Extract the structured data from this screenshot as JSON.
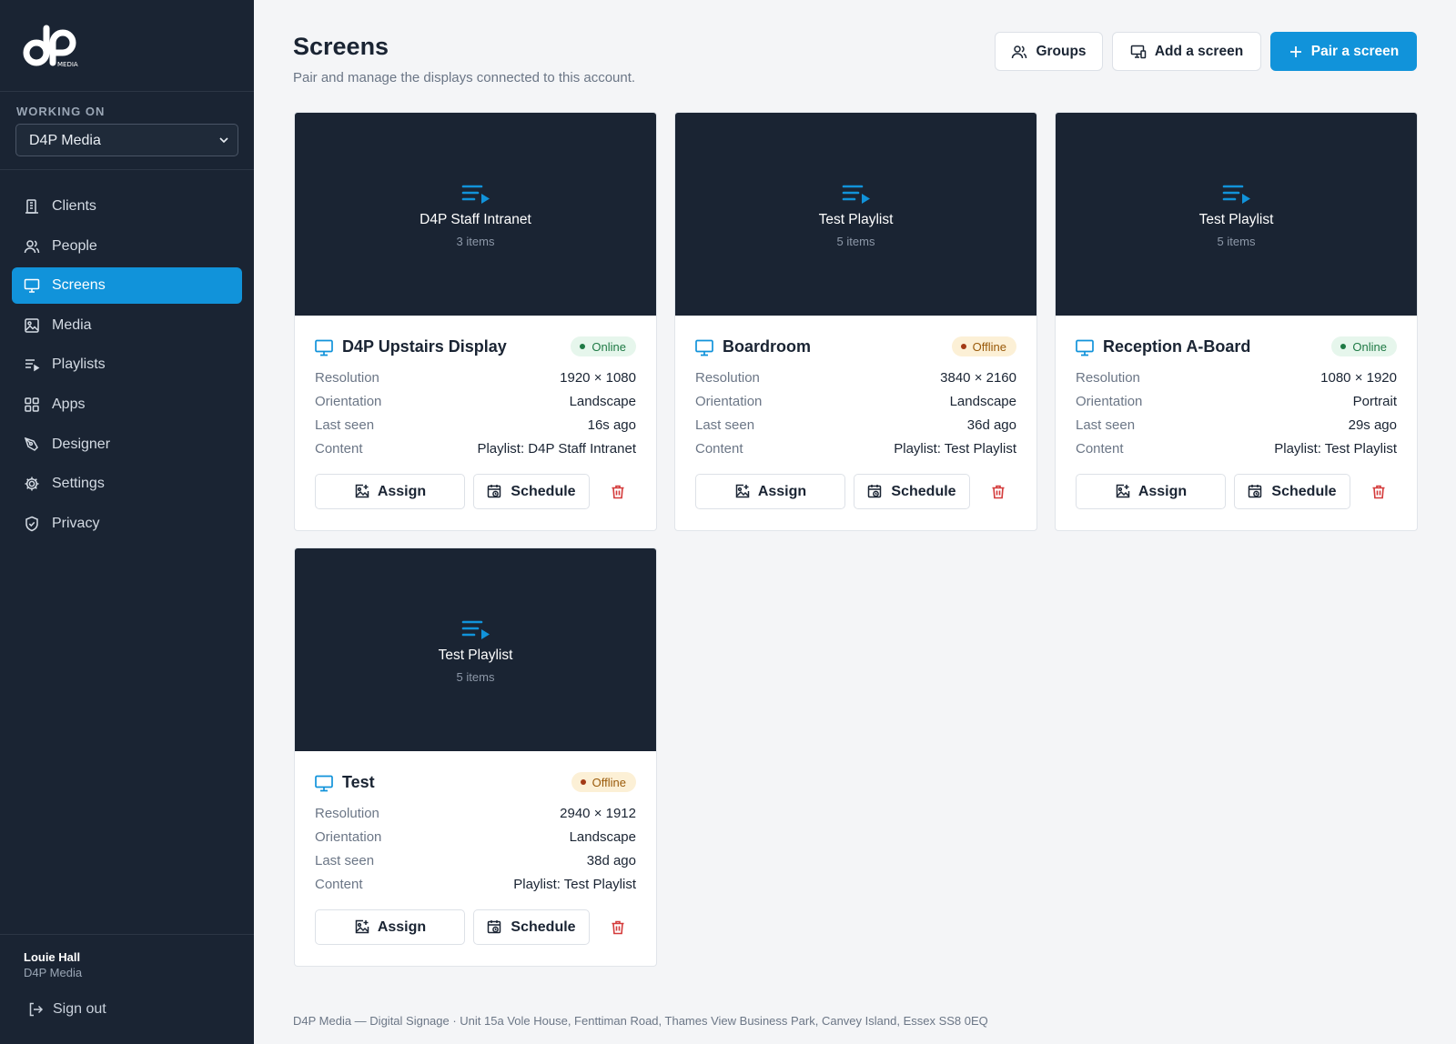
{
  "brand": {
    "logo_text": "dP",
    "logo_sub": "MEDIA",
    "accent": "#1193da",
    "sidebar_bg": "#1a2433"
  },
  "workspace": {
    "label": "WORKING ON",
    "selected": "D4P Media"
  },
  "nav": [
    {
      "label": "Clients",
      "icon": "building-icon"
    },
    {
      "label": "People",
      "icon": "users-icon"
    },
    {
      "label": "Screens",
      "icon": "monitor-icon",
      "active": true
    },
    {
      "label": "Media",
      "icon": "image-icon"
    },
    {
      "label": "Playlists",
      "icon": "playlist-icon"
    },
    {
      "label": "Apps",
      "icon": "grid-icon"
    },
    {
      "label": "Designer",
      "icon": "pen-tool-icon"
    },
    {
      "label": "Settings",
      "icon": "gear-icon"
    },
    {
      "label": "Privacy",
      "icon": "shield-icon"
    }
  ],
  "user": {
    "name": "Louie Hall",
    "org": "D4P Media",
    "signout_label": "Sign out"
  },
  "header": {
    "title": "Screens",
    "subtitle": "Pair and manage the displays connected to this account.",
    "groups_label": "Groups",
    "add_label": "Add a screen",
    "pair_label": "Pair a screen"
  },
  "field_labels": {
    "resolution": "Resolution",
    "orientation": "Orientation",
    "last_seen": "Last seen",
    "content": "Content"
  },
  "actions": {
    "assign": "Assign",
    "schedule": "Schedule"
  },
  "screens": [
    {
      "preview_title": "D4P Staff Intranet",
      "preview_count": "3 items",
      "name": "D4P Upstairs Display",
      "status": "Online",
      "resolution": "1920 × 1080",
      "orientation": "Landscape",
      "last_seen": "16s ago",
      "content": "Playlist: D4P Staff Intranet"
    },
    {
      "preview_title": "Test Playlist",
      "preview_count": "5 items",
      "name": "Boardroom",
      "status": "Offline",
      "resolution": "3840 × 2160",
      "orientation": "Landscape",
      "last_seen": "36d ago",
      "content": "Playlist: Test Playlist"
    },
    {
      "preview_title": "Test Playlist",
      "preview_count": "5 items",
      "name": "Reception A-Board",
      "status": "Online",
      "resolution": "1080 × 1920",
      "orientation": "Portrait",
      "last_seen": "29s ago",
      "content": "Playlist: Test Playlist"
    },
    {
      "preview_title": "Test Playlist",
      "preview_count": "5 items",
      "name": "Test",
      "status": "Offline",
      "resolution": "2940 × 1912",
      "orientation": "Landscape",
      "last_seen": "38d ago",
      "content": "Playlist: Test Playlist"
    }
  ],
  "footer": "D4P Media — Digital Signage · Unit 15a Vole House, Fenttiman Road, Thames View Business Park, Canvey Island, Essex SS8 0EQ"
}
